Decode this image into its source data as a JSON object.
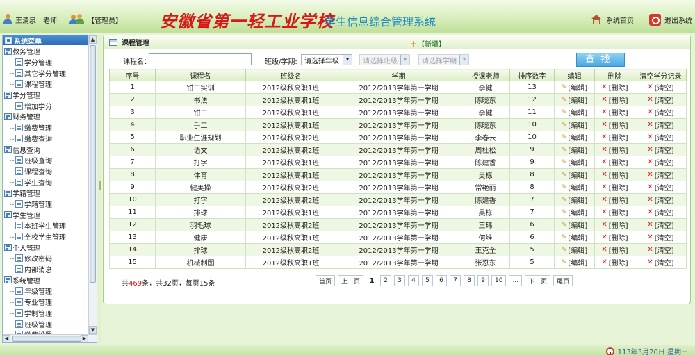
{
  "header": {
    "user_name": "王清泉",
    "user_role": "老师",
    "user_group": "【管理员】",
    "school_name": "安徽省第一轻工业学校",
    "system_name": "学生信息综合管理系统",
    "home_label": "系统首页",
    "exit_label": "退出系统"
  },
  "sidebar": {
    "title": "系统菜单",
    "groups": [
      {
        "label": "教务管理",
        "items": [
          "学分管理",
          "其它学分管理",
          "课程管理"
        ]
      },
      {
        "label": "学分管理",
        "items": [
          "增加学分"
        ]
      },
      {
        "label": "财务管理",
        "items": [
          "缴费管理",
          "缴费查询"
        ]
      },
      {
        "label": "信息查询",
        "items": [
          "班级查询",
          "课程查询",
          "学生查询"
        ]
      },
      {
        "label": "学籍管理",
        "items": [
          "学籍管理"
        ]
      },
      {
        "label": "学生管理",
        "items": [
          "本班学生管理",
          "全校学生管理"
        ]
      },
      {
        "label": "个人管理",
        "items": [
          "修改密码",
          "内部消息"
        ]
      },
      {
        "label": "系统管理",
        "items": [
          "年级管理",
          "专业管理",
          "学制管理",
          "班级管理",
          "缴费设置"
        ]
      }
    ]
  },
  "panel": {
    "title": "课程管理",
    "add_label": "【新增】"
  },
  "filters": {
    "course_label": "课程名：",
    "course_value": "",
    "class_term_label": "班级/学期:",
    "grade_select": "请选择年级",
    "class_select": "请选择班级",
    "term_select": "请选择学期",
    "search_label": "查找"
  },
  "table": {
    "columns": [
      "序号",
      "课程名",
      "班级名",
      "学期",
      "授课老师",
      "排序数字",
      "编辑",
      "删除",
      "清空学分记录"
    ],
    "edit_label": "[编辑]",
    "delete_label": "[删除]",
    "clear_label": "[清空]",
    "rows": [
      [
        "1",
        "钳工实训",
        "2012级秋高职1班",
        "2012/2013学年第一学期",
        "李健",
        "13"
      ],
      [
        "2",
        "书法",
        "2012级秋高职1班",
        "2012/2013学年第一学期",
        "陈晓东",
        "12"
      ],
      [
        "3",
        "钳工",
        "2012级秋高职1班",
        "2012/2013学年第一学期",
        "李健",
        "11"
      ],
      [
        "4",
        "手工",
        "2012级秋高职1班",
        "2012/2013学年第一学期",
        "陈晓东",
        "10"
      ],
      [
        "5",
        "职业生涯规划",
        "2012级秋高职2班",
        "2012/2013学年第一学期",
        "李春云",
        "10"
      ],
      [
        "6",
        "语文",
        "2012级秋高职2班",
        "2012/2013学年第一学期",
        "周杜松",
        "9"
      ],
      [
        "7",
        "打字",
        "2012级秋高职1班",
        "2012/2013学年第一学期",
        "陈建香",
        "9"
      ],
      [
        "8",
        "体育",
        "2012级秋高职1班",
        "2012/2013学年第一学期",
        "吴栋",
        "8"
      ],
      [
        "9",
        "健美操",
        "2012级秋高职2班",
        "2012/2013学年第一学期",
        "常艳丽",
        "8"
      ],
      [
        "10",
        "打字",
        "2012级秋高职2班",
        "2012/2013学年第一学期",
        "陈建香",
        "7"
      ],
      [
        "11",
        "排球",
        "2012级秋高职1班",
        "2012/2013学年第一学期",
        "吴栋",
        "7"
      ],
      [
        "12",
        "羽毛球",
        "2012级秋高职2班",
        "2012/2013学年第一学期",
        "王玮",
        "6"
      ],
      [
        "13",
        "健康",
        "2012级秋高职1班",
        "2012/2013学年第一学期",
        "何维",
        "6"
      ],
      [
        "14",
        "排球",
        "2012级秋高职2班",
        "2012/2013学年第一学期",
        "王克全",
        "5"
      ],
      [
        "15",
        "机械制图",
        "2012级秋高职1班",
        "2012/2013学年第一学期",
        "张忍东",
        "5"
      ]
    ]
  },
  "pager": {
    "prefix": "共",
    "total": "469",
    "suffix": "条，共32页，每页15条",
    "first": "首页",
    "prev": "上一页",
    "pages": [
      "1",
      "2",
      "3",
      "4",
      "5",
      "6",
      "7",
      "8",
      "9",
      "10",
      "..."
    ],
    "next": "下一页",
    "last": "尾页"
  },
  "footer": {
    "date": "113年3月20日 星期三"
  }
}
